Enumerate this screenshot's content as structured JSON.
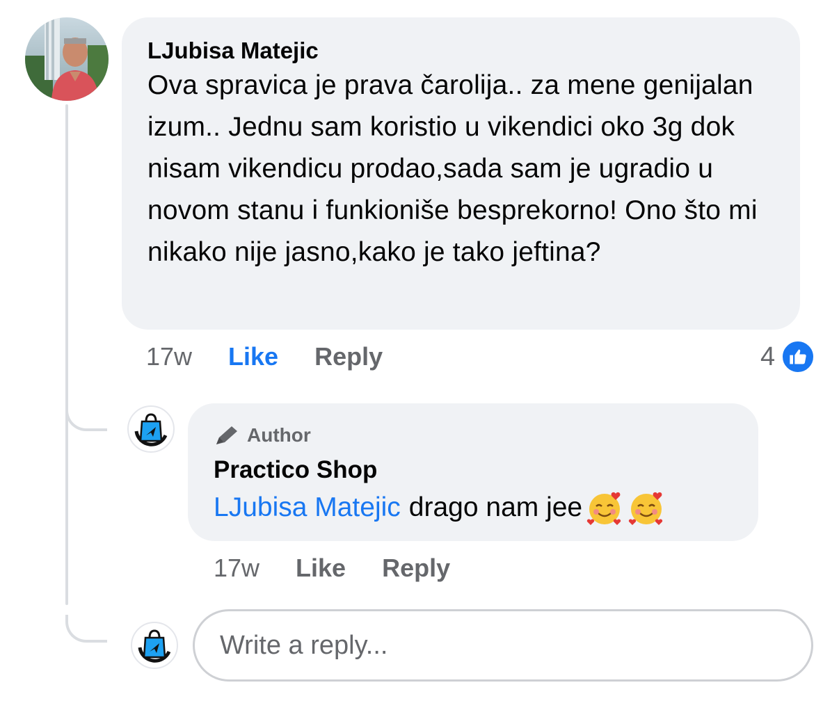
{
  "comment": {
    "author": "LJubisa Matejic",
    "text": "Ova spravica je prava čarolija.. za mene genijalan izum.. Jednu sam koristio u vikendici oko 3g dok nisam vikendicu prodao,sada sam je ugradio u novom stanu i funkioniše besprekorno! Ono što mi nikako nije jasno,kako je tako jeftina?",
    "time": "17w",
    "like_label": "Like",
    "reply_label": "Reply",
    "reaction_count": "4",
    "reaction_icon": "like-icon",
    "avatar_icon": "user-photo-avatar"
  },
  "reply": {
    "badge": "Author",
    "badge_icon": "pen-icon",
    "author": "Practico Shop",
    "mention": "LJubisa Matejic",
    "text": "drago nam jee",
    "emojis": [
      "smiling-face-with-hearts-emoji",
      "smiling-face-with-hearts-emoji"
    ],
    "time": "17w",
    "like_label": "Like",
    "reply_label": "Reply",
    "avatar_icon": "shopping-bag-logo"
  },
  "composer": {
    "placeholder": "Write a reply...",
    "value": ""
  },
  "colors": {
    "accent": "#1877f2",
    "bubble": "#f0f2f5",
    "muted": "#65676b",
    "line": "#dadde1"
  }
}
